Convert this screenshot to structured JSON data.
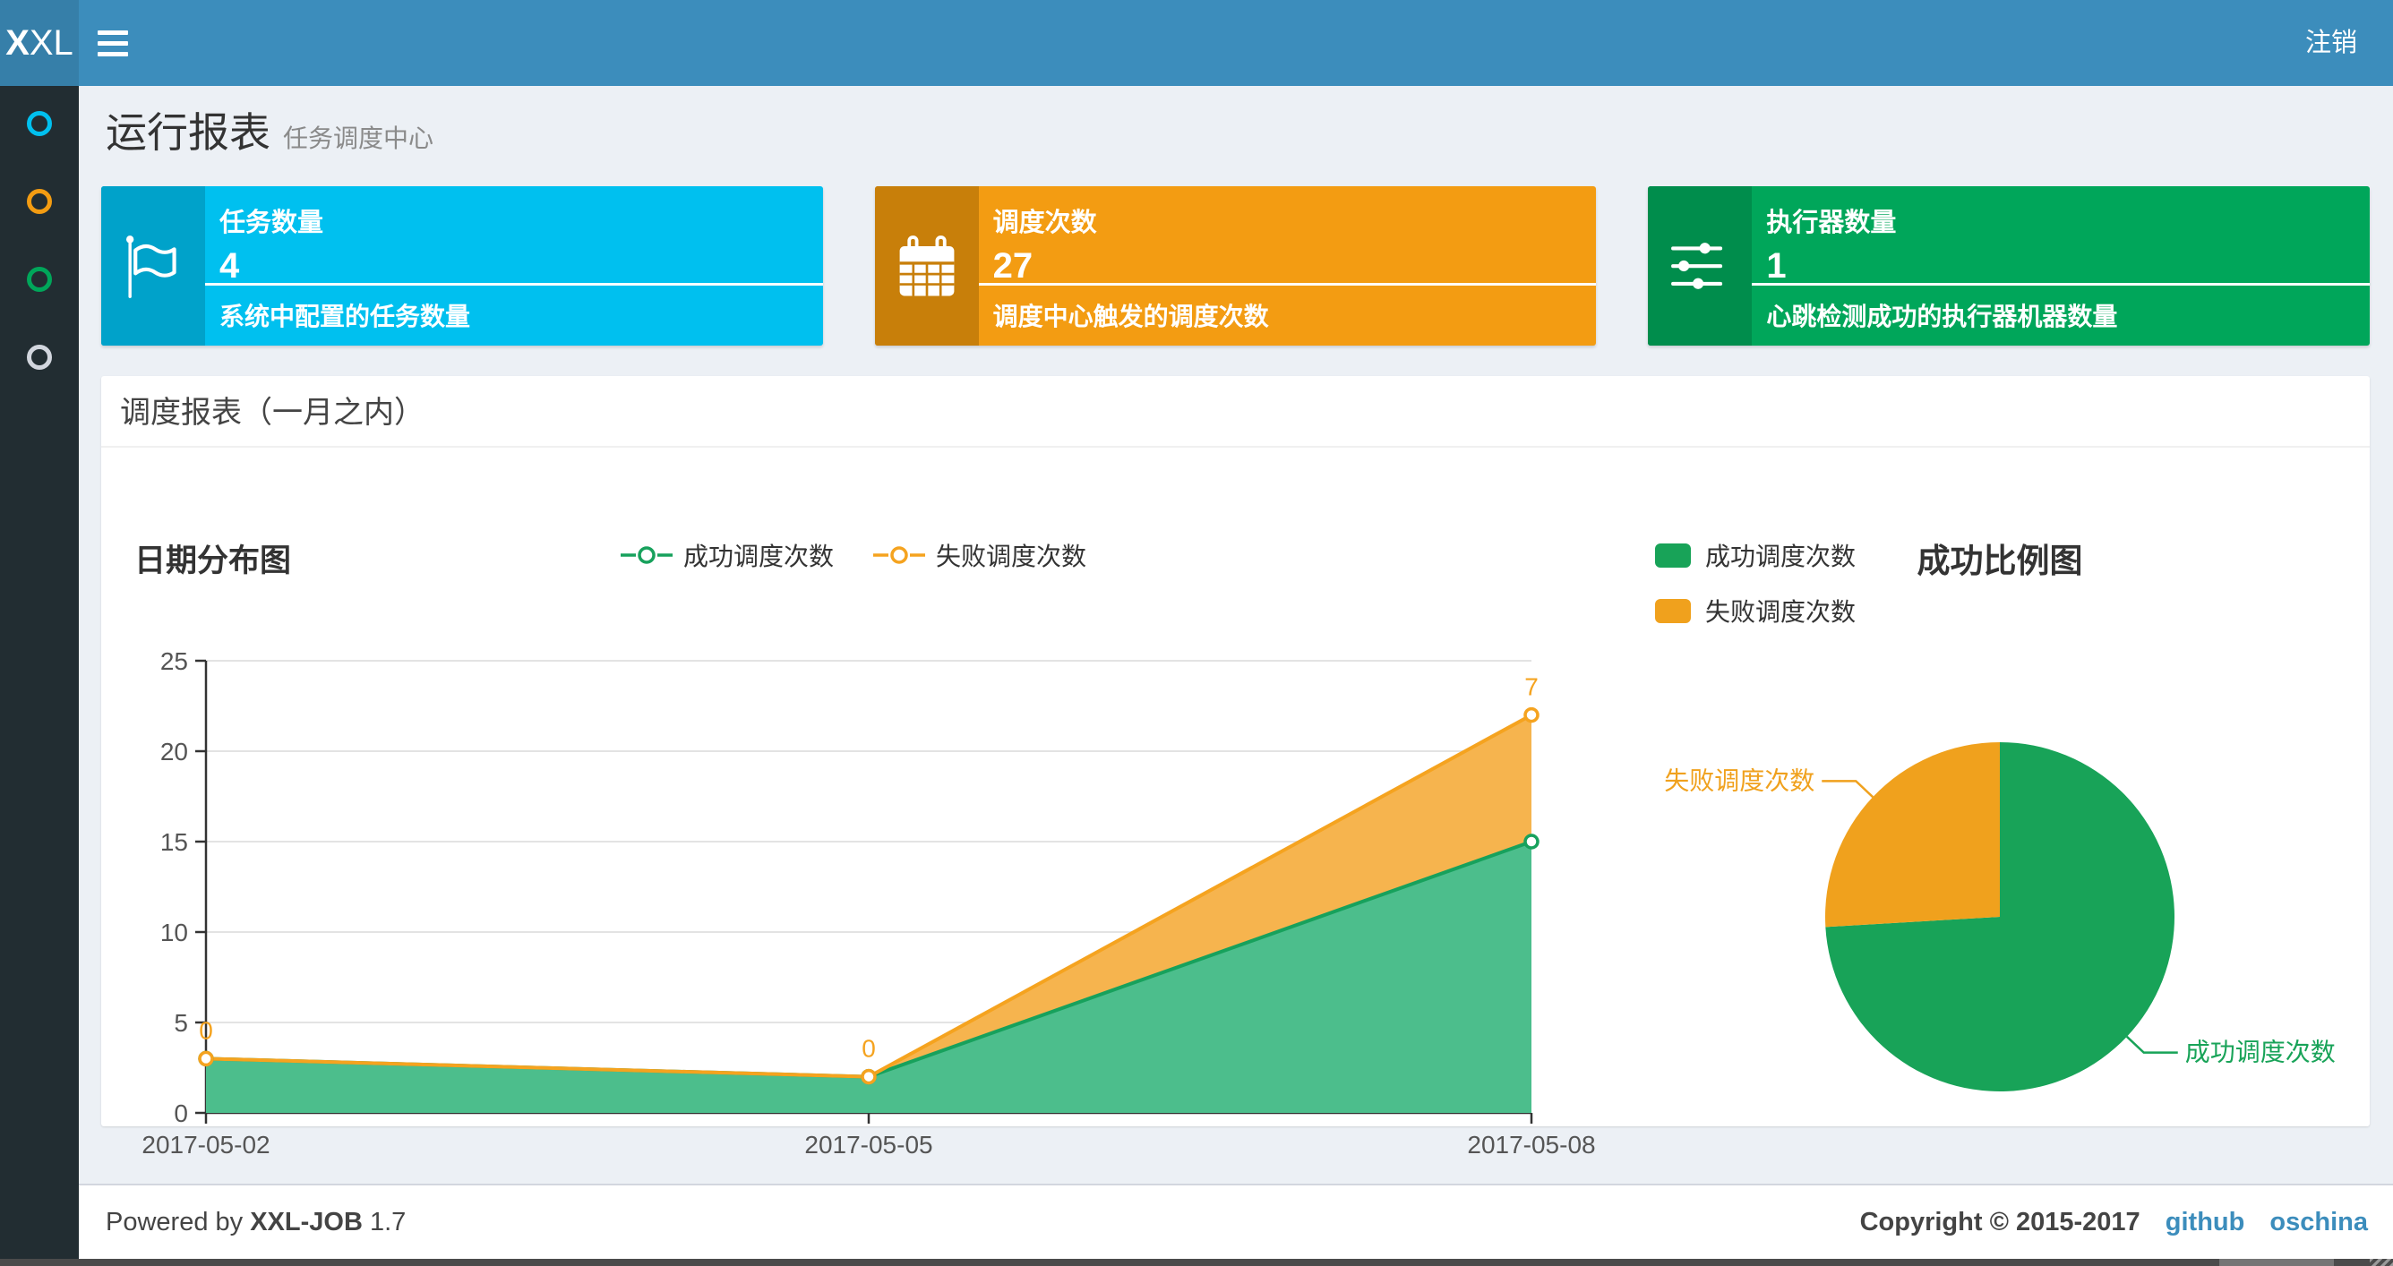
{
  "navbar": {
    "brand_bold": "X",
    "brand_rest": "XL",
    "logout_label": "注销"
  },
  "sidebar": {
    "items": [
      {
        "name": "menu-dot-1",
        "color": "#00c0ef"
      },
      {
        "name": "menu-dot-2",
        "color": "#f39c12"
      },
      {
        "name": "menu-dot-3",
        "color": "#00a65a"
      },
      {
        "name": "menu-dot-4",
        "color": "#d2d6de"
      }
    ]
  },
  "page_header": {
    "title": "运行报表",
    "subtitle": "任务调度中心"
  },
  "stat_cards": [
    {
      "label": "任务数量",
      "value": "4",
      "description": "系统中配置的任务数量",
      "icon": "flag-icon",
      "bg": "#00c0ef",
      "icon_bg": "#00a2ca"
    },
    {
      "label": "调度次数",
      "value": "27",
      "description": "调度中心触发的调度次数",
      "icon": "calendar-icon",
      "bg": "#f39c12",
      "icon_bg": "#c87f0a"
    },
    {
      "label": "执行器数量",
      "value": "1",
      "description": "心跳检测成功的执行器机器数量",
      "icon": "sliders-icon",
      "bg": "#00a65a",
      "icon_bg": "#008d4c"
    }
  ],
  "panel": {
    "title": "调度报表（一月之内）"
  },
  "chart_data": [
    {
      "type": "area",
      "title": "日期分布图",
      "stacked": true,
      "categories": [
        "2017-05-02",
        "2017-05-05",
        "2017-05-08"
      ],
      "series": [
        {
          "name": "成功调度次数",
          "values": [
            3,
            2,
            15
          ],
          "color": "#17a15c",
          "fill": "#4cbe8c",
          "labels_shown": false
        },
        {
          "name": "失败调度次数",
          "values": [
            0,
            0,
            7
          ],
          "color": "#f5a31f",
          "fill": "#f6b44e",
          "labels_shown": true
        }
      ],
      "ylim": [
        0,
        25
      ],
      "yticks": [
        0,
        5,
        10,
        15,
        20,
        25
      ],
      "grid": true,
      "legend_position": "top-center"
    },
    {
      "type": "pie",
      "title": "成功比例图",
      "slices": [
        {
          "name": "成功调度次数",
          "value": 20,
          "color": "#18a358"
        },
        {
          "name": "失败调度次数",
          "value": 7,
          "color": "#f0a11d"
        }
      ],
      "start_angle_deg": 0,
      "clockwise": true,
      "legend_position": "top-left"
    }
  ],
  "footer": {
    "powered_prefix": "Powered by",
    "product": "XXL-JOB",
    "version": "1.7",
    "copyright": "Copyright © 2015-2017",
    "links": [
      {
        "label": "github"
      },
      {
        "label": "oschina"
      }
    ]
  }
}
